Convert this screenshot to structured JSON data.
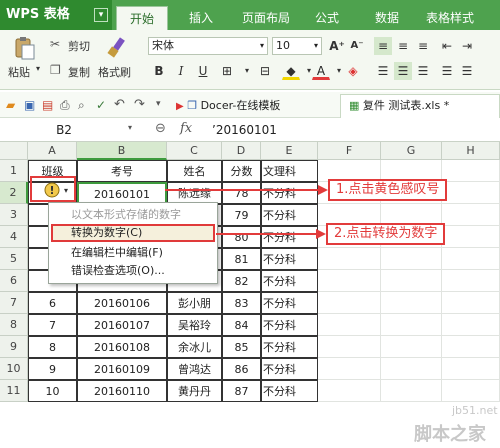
{
  "app": {
    "name": "WPS 表格",
    "menu_arrow": "▾"
  },
  "tabs": [
    "开始",
    "插入",
    "页面布局",
    "公式",
    "数据",
    "表格样式"
  ],
  "ribbon": {
    "paste": "粘贴",
    "cut": "剪切",
    "copy": "复制",
    "format_painter": "格式刷",
    "font_name": "宋体",
    "font_size": "10"
  },
  "doc_tabs": [
    {
      "label": "Docer-在线模板"
    },
    {
      "label": "复件 测试表.xls *"
    }
  ],
  "formula_bar": {
    "name_box": "B2",
    "fx": "fx",
    "value": "’20160101"
  },
  "columns": [
    "A",
    "B",
    "C",
    "D",
    "E",
    "F",
    "G",
    "H"
  ],
  "rows": [
    "1",
    "2",
    "3",
    "4",
    "5",
    "6",
    "7",
    "8",
    "9",
    "10",
    "11"
  ],
  "headers": [
    "班级",
    "考号",
    "姓名",
    "分数",
    "文理科"
  ],
  "table": [
    {
      "a": "",
      "b": "20160101",
      "c": "陈远缘",
      "d": "78",
      "e": "不分科"
    },
    {
      "a": "",
      "b": "",
      "c": "",
      "d": "79",
      "e": "不分科"
    },
    {
      "a": "",
      "b": "",
      "c": "",
      "d": "80",
      "e": "不分科"
    },
    {
      "a": "",
      "b": "",
      "c": "",
      "d": "81",
      "e": "不分科"
    },
    {
      "a": "",
      "b": "",
      "c": "",
      "d": "82",
      "e": "不分科"
    },
    {
      "a": "6",
      "b": "20160106",
      "c": "彭小朋",
      "d": "83",
      "e": "不分科"
    },
    {
      "a": "7",
      "b": "20160107",
      "c": "吴裕玲",
      "d": "84",
      "e": "不分科"
    },
    {
      "a": "8",
      "b": "20160108",
      "c": "余冰儿",
      "d": "85",
      "e": "不分科"
    },
    {
      "a": "9",
      "b": "20160109",
      "c": "曾鸿达",
      "d": "86",
      "e": "不分科"
    },
    {
      "a": "10",
      "b": "20160110",
      "c": "黄丹丹",
      "d": "87",
      "e": "不分科"
    }
  ],
  "context_menu": [
    "以文本形式存储的数字",
    "转换为数字(C)",
    "在编辑栏中编辑(F)",
    "错误检查选项(O)..."
  ],
  "callouts": [
    "1.点击黄色感叹号",
    "2.点击转换为数字"
  ],
  "watermark": {
    "site": "jb51.net",
    "name": "脚本之家"
  },
  "colors": {
    "accent_green": "#4ea24e",
    "callout_red": "#e23b3b",
    "warn_yellow": "#f2c94c"
  }
}
